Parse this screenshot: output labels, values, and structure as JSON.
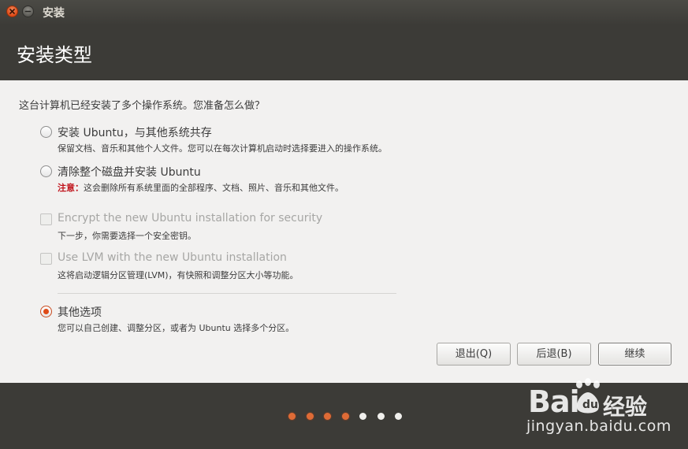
{
  "window": {
    "title": "安装"
  },
  "header": {
    "page_title": "安装类型"
  },
  "main": {
    "question": "这台计算机已经安装了多个操作系统。您准备怎么做？",
    "options": [
      {
        "type": "radio",
        "checked": false,
        "enabled": true,
        "label": "安装 Ubuntu，与其他系统共存",
        "description": "保留文档、音乐和其他个人文件。您可以在每次计算机启动时选择要进入的操作系统。"
      },
      {
        "type": "radio",
        "checked": false,
        "enabled": true,
        "label": "清除整个磁盘并安装 Ubuntu",
        "warning_prefix": "注意：",
        "description": "这会删除所有系统里面的全部程序、文档、照片、音乐和其他文件。"
      },
      {
        "type": "checkbox",
        "checked": false,
        "enabled": false,
        "label": "Encrypt the new Ubuntu installation for security",
        "description": "下一步，你需要选择一个安全密钥。"
      },
      {
        "type": "checkbox",
        "checked": false,
        "enabled": false,
        "label": "Use LVM with the new Ubuntu installation",
        "description": "这将启动逻辑分区管理(LVM)，有快照和调整分区大小等功能。"
      },
      {
        "type": "radio",
        "checked": true,
        "enabled": true,
        "label": "其他选项",
        "description": "您可以自己创建、调整分区，或者为 Ubuntu 选择多个分区。"
      }
    ]
  },
  "buttons": {
    "quit": "退出(Q)",
    "back": "后退(B)",
    "continue": "继续"
  },
  "progress": {
    "total_steps": 7,
    "completed_steps": 4
  },
  "watermark": {
    "brand": "Bai",
    "brand_suffix": "经验",
    "url": "jingyan.baidu.com"
  },
  "colors": {
    "accent": "#df4a16",
    "warning": "#c0131b",
    "dark_bg": "#3c3b37",
    "content_bg": "#f2f1f0"
  }
}
